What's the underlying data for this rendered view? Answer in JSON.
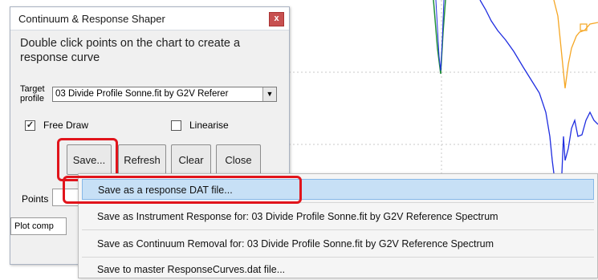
{
  "dialog": {
    "title": "Continuum & Response Shaper",
    "close_glyph": "x",
    "instructions": "Double click points on the chart to create a response curve",
    "target_label": "Target profile",
    "target_value": "03 Divide Profile Sonne.fit by G2V Referer",
    "free_draw_label": "Free Draw",
    "free_draw_checked": true,
    "linearise_label": "Linearise",
    "linearise_checked": false,
    "buttons": {
      "save": "Save...",
      "refresh": "Refresh",
      "clear": "Clear",
      "close": "Close"
    },
    "points_label": "Points",
    "plot_comp_label": "Plot comp"
  },
  "menu": {
    "items": [
      "Save as a response DAT file...",
      "Save as Instrument Response for: 03 Divide Profile Sonne.fit by G2V Reference Spectrum",
      "Save as Continuum Removal for: 03 Divide Profile Sonne.fit by G2V Reference Spectrum",
      "Save to master ResponseCurves.dat file..."
    ],
    "selected_index": 0
  },
  "colors": {
    "highlight_red": "#e1141b",
    "blue_curve": "#1f2de0",
    "orange_curve": "#f5a623",
    "green_curve": "#1e8f3a"
  }
}
